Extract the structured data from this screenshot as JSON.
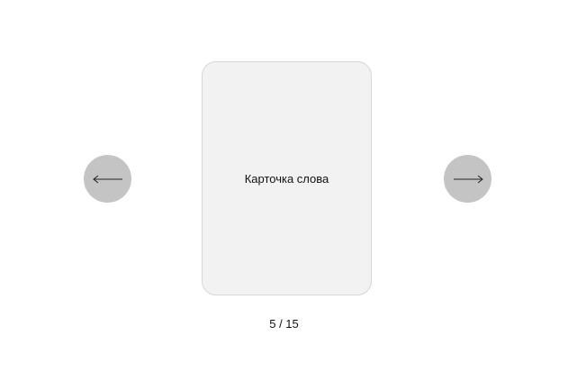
{
  "card": {
    "text": "Карточка слова"
  },
  "navigation": {
    "prev_icon": "arrow-left-icon",
    "next_icon": "arrow-right-icon",
    "counter": "5 / 15"
  },
  "colors": {
    "background": "#ffffff",
    "nav_button": "#c4c4c4",
    "card_background": "#f2f2f2",
    "card_border": "#d6d6d6",
    "text": "#111111"
  }
}
